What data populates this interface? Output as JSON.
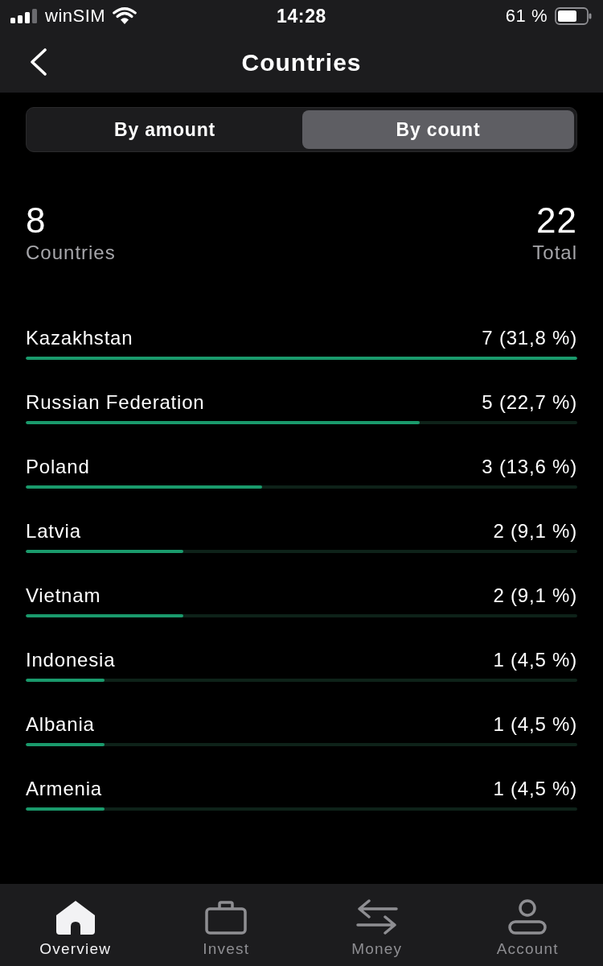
{
  "status_bar": {
    "carrier": "winSIM",
    "time": "14:28",
    "battery": "61 %"
  },
  "nav": {
    "title": "Countries"
  },
  "segments": [
    {
      "label": "By amount",
      "selected": false
    },
    {
      "label": "By count",
      "selected": true
    }
  ],
  "summary": [
    {
      "value": "8",
      "label": "Countries"
    },
    {
      "value": "22",
      "label": "Total"
    }
  ],
  "countries": [
    {
      "name": "Kazakhstan",
      "reading": "7 (31,8 %)",
      "level": 1
    },
    {
      "name": "Russian Federation",
      "reading": "5 (22,7 %)",
      "level": 0.714
    },
    {
      "name": "Poland",
      "reading": "3 (13,6 %)",
      "level": 0.429
    },
    {
      "name": "Latvia",
      "reading": "2 (9,1 %)",
      "level": 0.286
    },
    {
      "name": "Vietnam",
      "reading": "2 (9,1 %)",
      "level": 0.286
    },
    {
      "name": "Indonesia",
      "reading": "1 (4,5 %)",
      "level": 0.143
    },
    {
      "name": "Albania",
      "reading": "1 (4,5 %)",
      "level": 0.143
    },
    {
      "name": "Armenia",
      "reading": "1 (4,5 %)",
      "level": 0.143
    }
  ],
  "tab_bar": [
    {
      "label": "Overview",
      "kind": "home",
      "selected": true
    },
    {
      "label": "Invest",
      "kind": "briefcase",
      "selected": false
    },
    {
      "label": "Money",
      "kind": "transfer",
      "selected": false
    },
    {
      "label": "Account",
      "kind": "person",
      "selected": false
    }
  ]
}
